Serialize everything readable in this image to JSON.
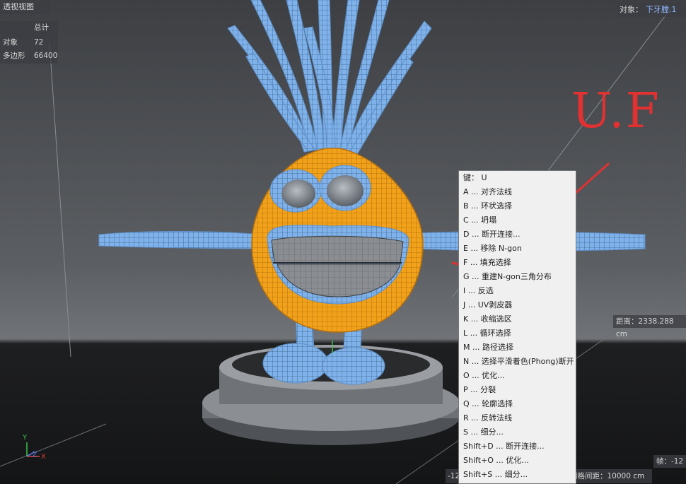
{
  "viewport": {
    "title": "透视视图",
    "stats": {
      "header": "总计",
      "rows": [
        {
          "label": "对象",
          "value": "72"
        },
        {
          "label": "多边形",
          "value": "66400"
        }
      ]
    },
    "object_label": "对象：",
    "object_name": "下牙膛.1",
    "distance": "距离：2338.288 cm",
    "frame": "帧：-12",
    "grid_spacing": "网格间距：10000 cm",
    "bottom_left_value": "-12",
    "axis": {
      "y": "Y",
      "z": "Z",
      "x": "X"
    }
  },
  "shortcut_menu": {
    "header": "键：  U",
    "items": [
      "A ... 对齐法线",
      "B ... 环状选择",
      "C ... 坍塌",
      "D ... 断开连接...",
      "E ... 移除 N-gon",
      "F ... 填充选择",
      "G ... 重建N-gon三角分布",
      "I ... 反选",
      "J ... UV剥皮器",
      "K ... 收缩选区",
      "L ... 循环选择",
      "M ... 路径选择",
      "N ... 选择平滑着色(Phong)断开",
      "O ... 优化...",
      "P ... 分裂",
      "Q ... 轮廓选择",
      "R ... 反转法线",
      "S ... 细分...",
      "Shift+D ... 断开连接...",
      "Shift+O ... 优化...",
      "Shift+S ... 细分..."
    ],
    "highlighted_index": 5
  },
  "annotation": {
    "text": "U.F",
    "color": "#e23131"
  },
  "colors": {
    "selection_orange": "#f2a21a",
    "mesh_blue": "#7fb2ea",
    "background": "#3b3d40"
  }
}
